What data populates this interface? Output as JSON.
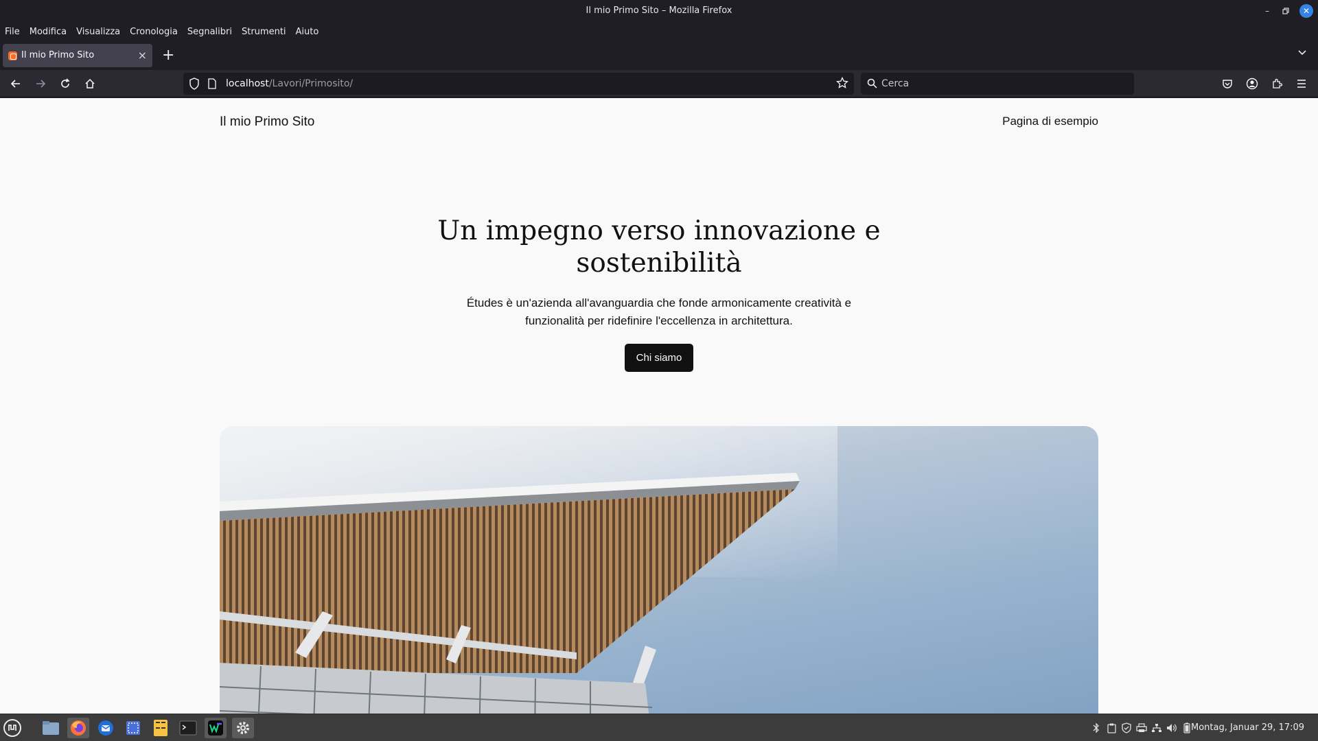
{
  "window": {
    "title": "Il mio Primo Sito – Mozilla Firefox",
    "controls": [
      "minimize-icon",
      "restore-icon",
      "close-icon"
    ]
  },
  "menubar": {
    "items": [
      {
        "label": "File"
      },
      {
        "label": "Modifica"
      },
      {
        "label": "Visualizza"
      },
      {
        "label": "Cronologia"
      },
      {
        "label": "Segnalibri"
      },
      {
        "label": "Strumenti"
      },
      {
        "label": "Aiuto"
      }
    ]
  },
  "tabs": [
    {
      "label": "Il mio Primo Sito",
      "active": true,
      "favicon": "xampp-icon"
    }
  ],
  "nav": {
    "url_host": "localhost",
    "url_path": "/Lavori/Primosito/",
    "search_placeholder": "Cerca",
    "accent": "#3584e4"
  },
  "page": {
    "site_title": "Il mio Primo Sito",
    "nav_link": "Pagina di esempio",
    "hero_title": "Un impegno verso innovazione e sostenibilità",
    "hero_text": "Études è un'azienda all'avanguardia che fonde armonicamente creatività e funzionalità per ridefinire l'eccellenza in architettura.",
    "cta_label": "Chi siamo",
    "hero_image": "modern-building-roof-photo"
  },
  "taskbar": {
    "apps": [
      "mint-menu-icon",
      "file-manager-icon",
      "firefox-icon",
      "thunderbird-icon",
      "screenshot-icon",
      "calculator-icon",
      "terminal-icon",
      "webstorm-icon",
      "settings-icon"
    ],
    "tray": [
      "bluetooth-icon",
      "clipboard-icon",
      "shield-icon",
      "printer-icon",
      "network-icon",
      "volume-icon",
      "battery-icon"
    ],
    "clock": "Montag, Januar 29, 17:09"
  }
}
